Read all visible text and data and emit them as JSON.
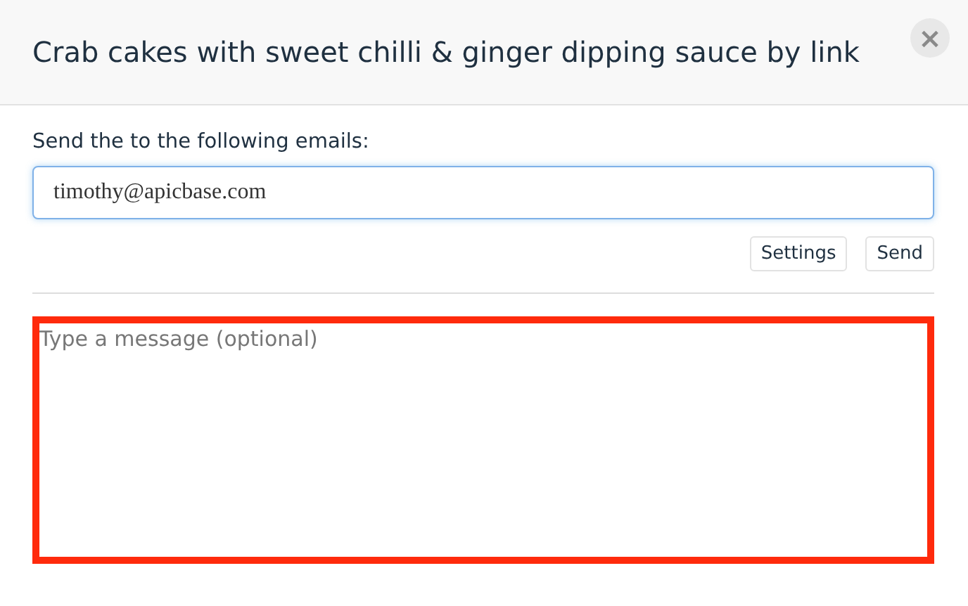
{
  "dialog": {
    "title": "Crab cakes with sweet chilli & ginger dipping sauce by link",
    "close_icon": "×"
  },
  "recipients": {
    "label": "Send the to the following emails:",
    "value": "timothy@apicbase.com",
    "focused": true
  },
  "buttons": [
    {
      "label": "Settings"
    },
    {
      "label": "Send"
    }
  ],
  "message": {
    "placeholder": "Type a message (optional)",
    "highlighted": true
  }
}
